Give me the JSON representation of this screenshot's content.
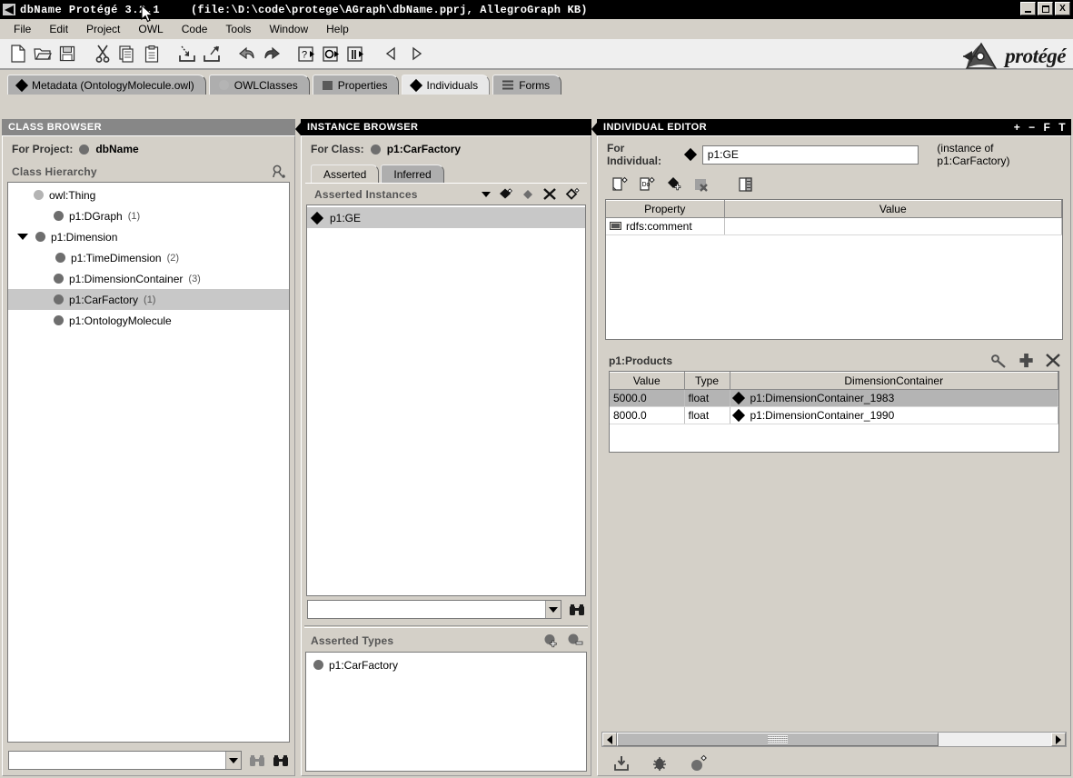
{
  "window": {
    "app_name": "dbName  Protégé 3.2.1",
    "file_info": "(file:\\D:\\code\\protege\\AGraph\\dbName.pprj, AllegroGraph KB)",
    "minimize_label": "_",
    "maximize_label": "□",
    "close_label": "X"
  },
  "menubar": {
    "items": [
      {
        "label": "File"
      },
      {
        "label": "Edit"
      },
      {
        "label": "Project"
      },
      {
        "label": "OWL"
      },
      {
        "label": "Code"
      },
      {
        "label": "Tools"
      },
      {
        "label": "Window"
      },
      {
        "label": "Help"
      }
    ]
  },
  "toolbar": {
    "icons": [
      "new-file-icon",
      "open-folder-icon",
      "save-icon",
      "cut-icon",
      "copy-icon",
      "paste-icon",
      "import-icon",
      "export-icon",
      "undo-icon",
      "redo-icon",
      "query-icon",
      "run-icon",
      "step-icon",
      "back-icon",
      "forward-icon"
    ],
    "logo_text": "protégé"
  },
  "tabs": [
    {
      "label": "Metadata (OntologyMolecule.owl)",
      "icon": "diamond-icon",
      "active": false
    },
    {
      "label": "OWLClasses",
      "icon": "circle-icon",
      "active": false
    },
    {
      "label": "Properties",
      "icon": "square-icon",
      "active": false
    },
    {
      "label": "Individuals",
      "icon": "diamond-icon",
      "active": true
    },
    {
      "label": "Forms",
      "icon": "lines-icon",
      "active": false
    }
  ],
  "class_browser": {
    "header": "CLASS BROWSER",
    "for_project_label": "For Project:",
    "project_name": "dbName",
    "hierarchy_label": "Class Hierarchy",
    "hierarchy_icon": "find-class-icon",
    "tree": [
      {
        "label": "owl:Thing",
        "count": "",
        "indent": 0,
        "icon": "circle-light-icon",
        "expanded": false,
        "selected": false
      },
      {
        "label": "p1:DGraph",
        "count": "(1)",
        "indent": 1,
        "icon": "circle-icon",
        "expanded": false,
        "selected": false
      },
      {
        "label": "p1:Dimension",
        "count": "",
        "indent": 1,
        "icon": "circle-icon",
        "expanded": true,
        "selected": false
      },
      {
        "label": "p1:TimeDimension",
        "count": "(2)",
        "indent": 2,
        "icon": "circle-icon",
        "expanded": false,
        "selected": false
      },
      {
        "label": "p1:DimensionContainer",
        "count": "(3)",
        "indent": 1,
        "icon": "circle-icon",
        "expanded": false,
        "selected": false
      },
      {
        "label": "p1:CarFactory",
        "count": "(1)",
        "indent": 1,
        "icon": "circle-icon",
        "expanded": false,
        "selected": true
      },
      {
        "label": "p1:OntologyMolecule",
        "count": "",
        "indent": 1,
        "icon": "circle-icon",
        "expanded": false,
        "selected": false
      }
    ],
    "search_value": "",
    "search_icons": [
      "binoculars-light-icon",
      "binoculars-dark-icon"
    ]
  },
  "instance_browser": {
    "header": "INSTANCE BROWSER",
    "for_class_label": "For Class:",
    "class_name": "p1:CarFactory",
    "subtabs": [
      {
        "label": "Asserted",
        "active": true
      },
      {
        "label": "Inferred",
        "active": false
      }
    ],
    "instances_label": "Asserted Instances",
    "instances_icons": [
      "sort-caret-icon",
      "create-instance-icon",
      "duplicate-instance-icon",
      "delete-instance-icon",
      "remove-instance-icon"
    ],
    "instances": [
      {
        "label": "p1:GE",
        "icon": "diamond-icon",
        "selected": true
      }
    ],
    "search_value": "",
    "search_icon": "binoculars-dark-icon",
    "asserted_types_label": "Asserted Types",
    "types_icons": [
      "add-type-icon",
      "remove-type-icon"
    ],
    "types": [
      {
        "label": "p1:CarFactory",
        "icon": "circle-icon"
      }
    ]
  },
  "individual_editor": {
    "header": "INDIVIDUAL EDITOR",
    "header_icons": [
      "plus-icon",
      "minus-icon",
      "f-icon",
      "t-icon"
    ],
    "header_icon_labels": [
      "+",
      "−",
      "F",
      "T"
    ],
    "for_individual_label": "For Individual:",
    "individual_value": "p1:GE",
    "instance_note": "(instance of p1:CarFactory)",
    "editor_icons": [
      "new-resource-icon",
      "duplicate-resource-icon",
      "add-individual-icon",
      "delete-individual-icon",
      "view-layout-icon"
    ],
    "property_table": {
      "columns": [
        "Property",
        "Value"
      ],
      "rows": [
        {
          "property": "rdfs:comment",
          "value": "",
          "icon": "datatype-property-icon"
        }
      ]
    },
    "products": {
      "title": "p1:Products",
      "icons": [
        "inspect-icon",
        "add-row-icon",
        "delete-row-icon"
      ],
      "columns": [
        "Value",
        "Type",
        "DimensionContainer"
      ],
      "rows": [
        {
          "value": "5000.0",
          "type": "float",
          "container": "p1:DimensionContainer_1983",
          "icon": "diamond-icon",
          "selected": true
        },
        {
          "value": "8000.0",
          "type": "float",
          "container": "p1:DimensionContainer_1990",
          "icon": "diamond-icon",
          "selected": false
        }
      ]
    },
    "bottom_icons": [
      "save-down-icon",
      "bug-icon",
      "instance-icon"
    ],
    "scroll": {
      "left_arrow": "◀",
      "right_arrow": "▶"
    }
  }
}
